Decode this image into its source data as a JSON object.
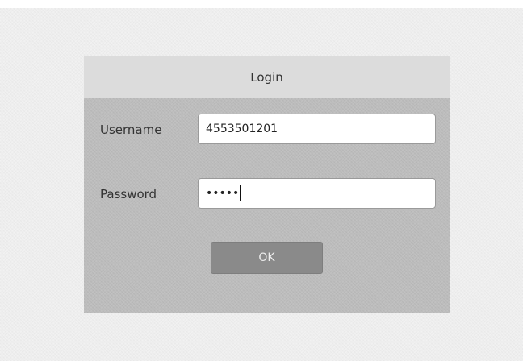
{
  "login": {
    "title": "Login",
    "username_label": "Username",
    "username_value": "4553501201",
    "password_label": "Password",
    "password_display": "•••••",
    "ok_label": "OK"
  }
}
